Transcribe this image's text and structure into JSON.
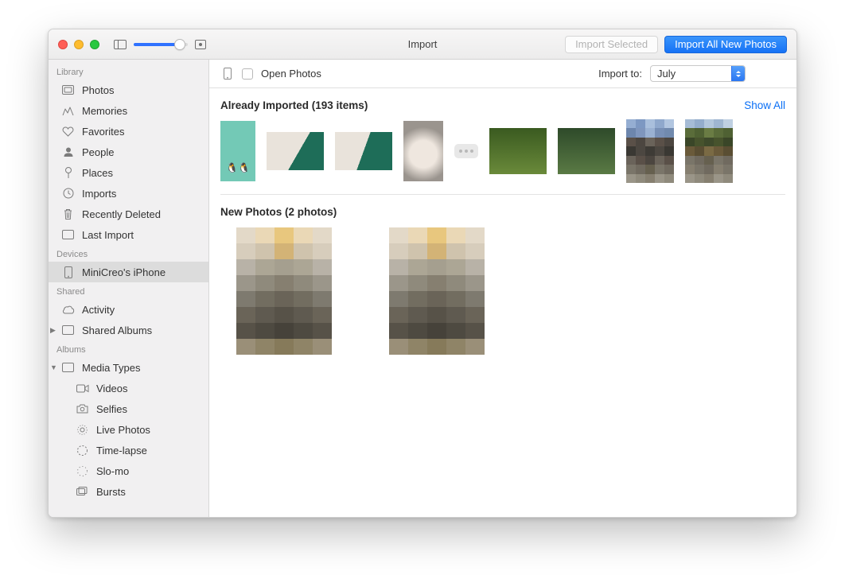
{
  "window": {
    "title": "Import"
  },
  "toolbar": {
    "import_selected": "Import Selected",
    "import_all": "Import All New Photos"
  },
  "subtoolbar": {
    "open_photos_label": "Open Photos",
    "import_to_label": "Import to:",
    "import_to_value": "July"
  },
  "sidebar": {
    "sections": {
      "library": "Library",
      "devices": "Devices",
      "shared": "Shared",
      "albums": "Albums"
    },
    "library": [
      {
        "label": "Photos"
      },
      {
        "label": "Memories"
      },
      {
        "label": "Favorites"
      },
      {
        "label": "People"
      },
      {
        "label": "Places"
      },
      {
        "label": "Imports"
      },
      {
        "label": "Recently Deleted"
      },
      {
        "label": "Last Import"
      }
    ],
    "devices": [
      {
        "label": "MiniCreo's iPhone",
        "selected": true
      }
    ],
    "shared": [
      {
        "label": "Activity"
      },
      {
        "label": "Shared Albums"
      }
    ],
    "albums": [
      {
        "label": "Media Types",
        "expanded": true,
        "children": [
          {
            "label": "Videos"
          },
          {
            "label": "Selfies"
          },
          {
            "label": "Live Photos"
          },
          {
            "label": "Time-lapse"
          },
          {
            "label": "Slo-mo"
          },
          {
            "label": "Bursts"
          }
        ]
      }
    ]
  },
  "sections": {
    "imported_heading": "Already Imported (193 items)",
    "show_all": "Show All",
    "new_heading": "New Photos (2 photos)"
  }
}
